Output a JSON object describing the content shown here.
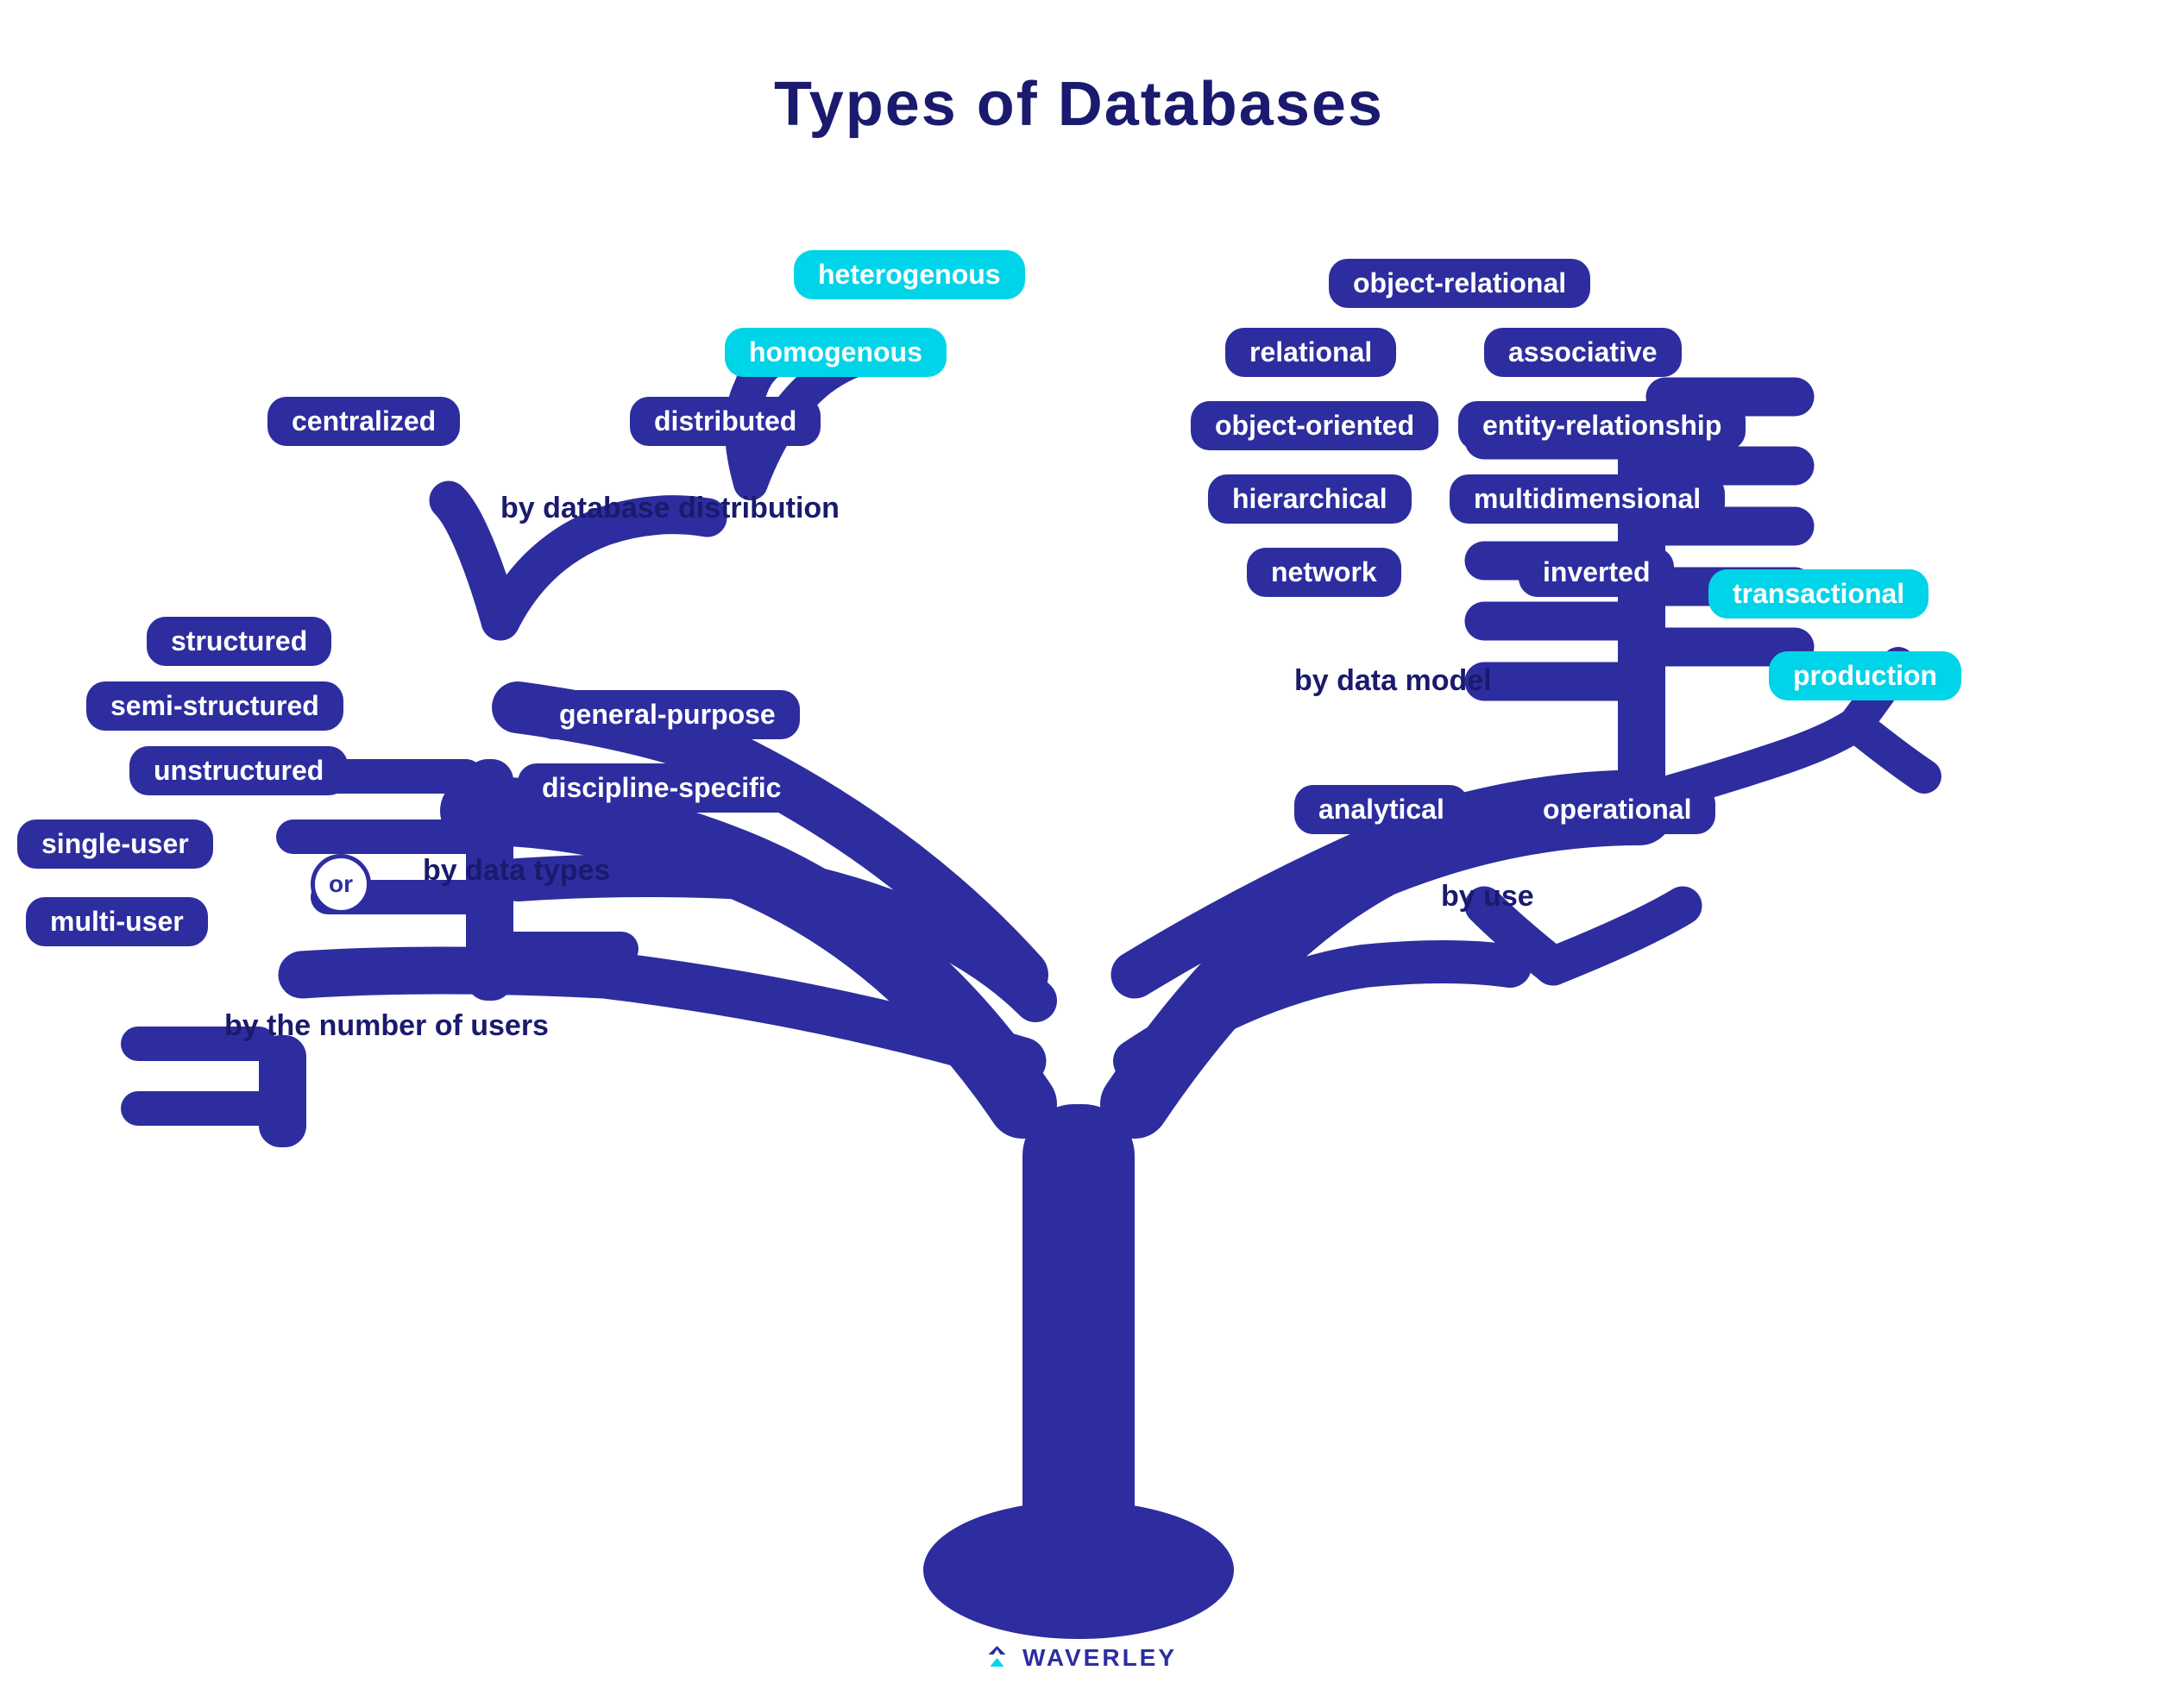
{
  "title": "Types of Databases",
  "nodes": {
    "heterogenous": "heterogenous",
    "homogenous": "homogenous",
    "centralized": "centralized",
    "distributed": "distributed",
    "by_database_distribution": "by database distribution",
    "structured": "structured",
    "semi_structured": "semi-structured",
    "unstructured": "unstructured",
    "general_purpose": "general-purpose",
    "discipline_specific": "discipline-specific",
    "by_data_types": "by data types",
    "single_user": "single-user",
    "multi_user": "multi-user",
    "by_number_of_users": "by the number of users",
    "or_label": "or",
    "object_relational": "object-relational",
    "relational": "relational",
    "associative": "associative",
    "object_oriented": "object-oriented",
    "entity_relationship": "entity-relationship",
    "hierarchical": "hierarchical",
    "multidimensional": "multidimensional",
    "network": "network",
    "inverted": "inverted",
    "by_data_model": "by data model",
    "transactional": "transactional",
    "production": "production",
    "analytical": "analytical",
    "operational": "operational",
    "by_use": "by use"
  },
  "footer": {
    "logo": "WAVERLEY"
  }
}
